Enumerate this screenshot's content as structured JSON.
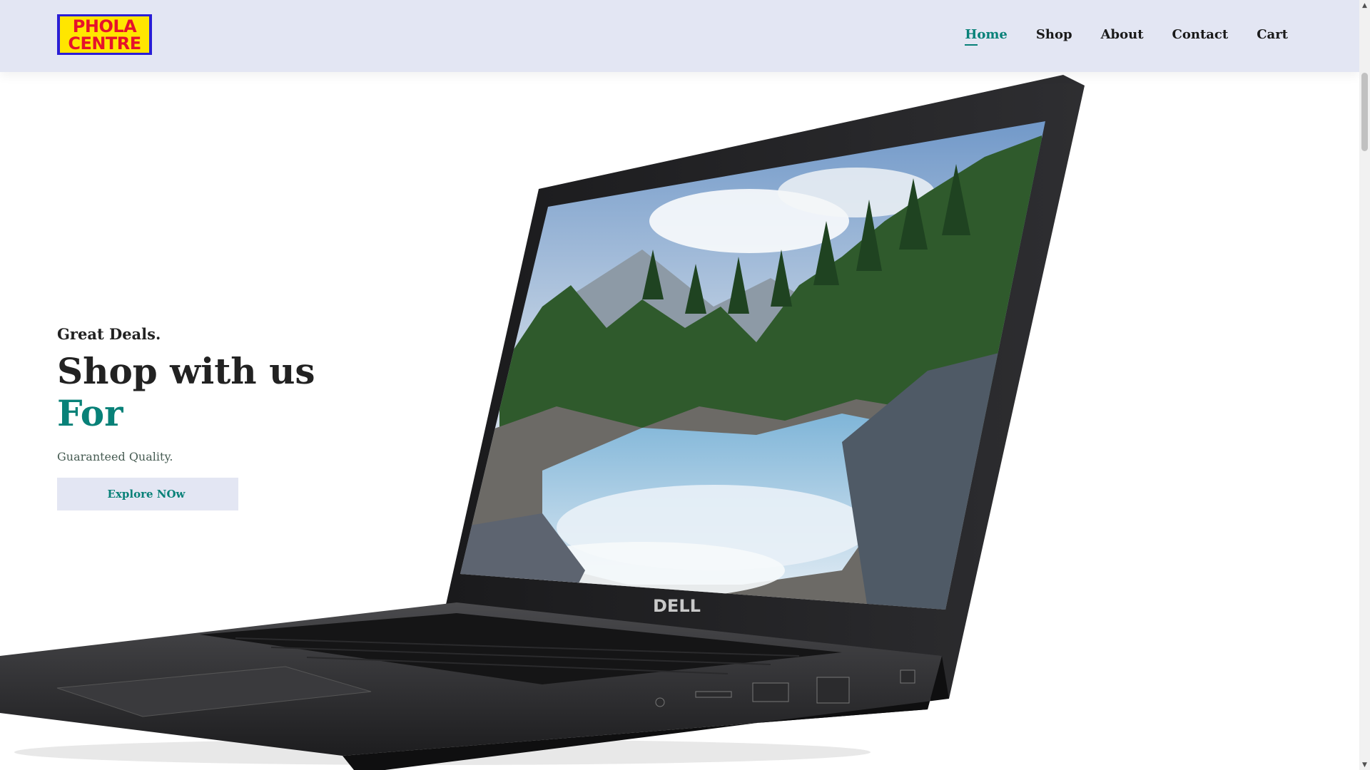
{
  "header": {
    "logo": {
      "line1": "PHOLA",
      "line2": "CENTRE"
    },
    "nav": [
      {
        "label": "Home",
        "active": true
      },
      {
        "label": "Shop",
        "active": false
      },
      {
        "label": "About",
        "active": false
      },
      {
        "label": "Contact",
        "active": false
      },
      {
        "label": "Cart",
        "active": false
      }
    ]
  },
  "hero": {
    "kicker": "Great Deals.",
    "headline": "Shop with us",
    "headline_accent": "For",
    "subtext": "Guaranteed Quality.",
    "cta_label": "Explore NOw",
    "product_brand": "DELL"
  },
  "colors": {
    "accent": "#088178",
    "header_bg": "#e3e6f3",
    "logo_yellow": "#ffe600",
    "logo_red": "#e6122b",
    "logo_blue": "#2a1ed6"
  },
  "scrollbar": {
    "up_icon": "triangle-up-icon",
    "down_icon": "triangle-down-icon"
  }
}
